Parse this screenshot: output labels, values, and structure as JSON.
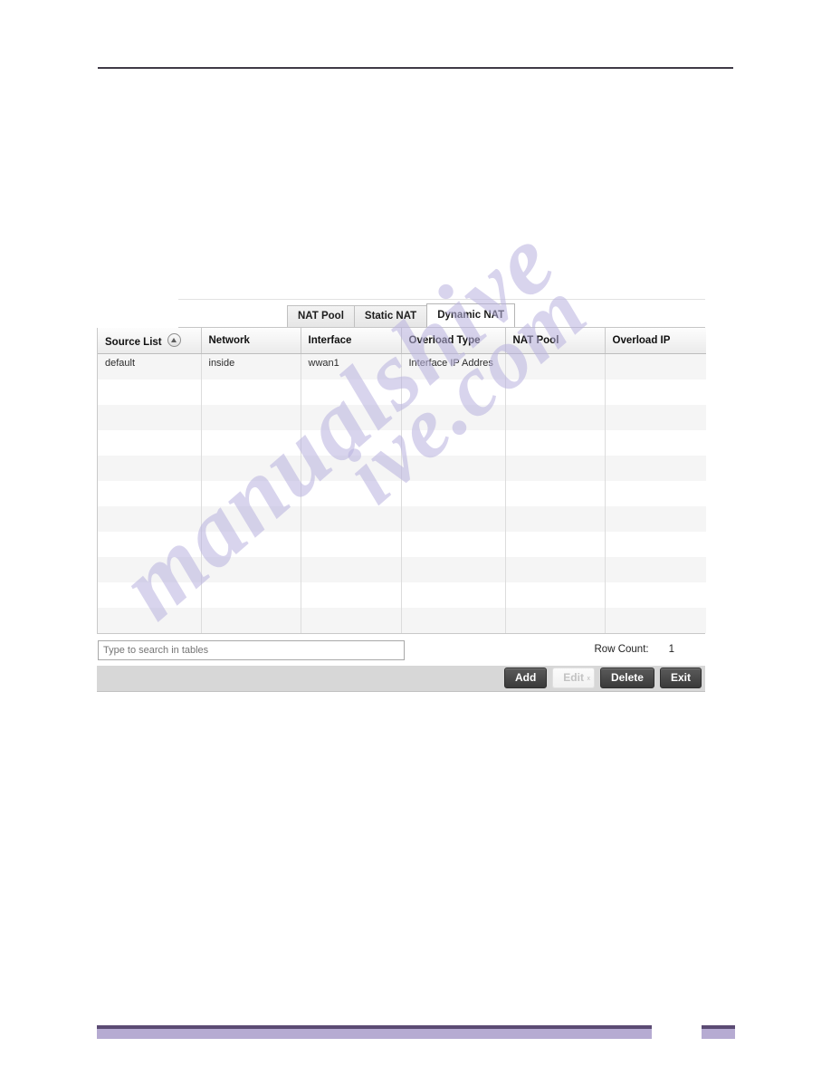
{
  "page": {
    "top_rule": "header-rule"
  },
  "watermark": {
    "line1": "manualshive",
    "line2": "ive.com"
  },
  "figure": {
    "tabs": [
      {
        "label": "NAT Pool",
        "active": false
      },
      {
        "label": "Static NAT",
        "active": false
      },
      {
        "label": "Dynamic NAT",
        "active": true
      }
    ],
    "table": {
      "columns": [
        {
          "label": "Source List",
          "sorted": true,
          "sort_icon": "sort-ascending-icon"
        },
        {
          "label": "Network",
          "sorted": false
        },
        {
          "label": "Interface",
          "sorted": false
        },
        {
          "label": "Overload Type",
          "sorted": false
        },
        {
          "label": "NAT Pool",
          "sorted": false
        },
        {
          "label": "Overload IP",
          "sorted": false
        }
      ],
      "rows": [
        [
          "default",
          "inside",
          "wwan1",
          "Interface IP Addres",
          "",
          ""
        ],
        [
          "",
          "",
          "",
          "",
          "",
          ""
        ],
        [
          "",
          "",
          "",
          "",
          "",
          ""
        ],
        [
          "",
          "",
          "",
          "",
          "",
          ""
        ],
        [
          "",
          "",
          "",
          "",
          "",
          ""
        ],
        [
          "",
          "",
          "",
          "",
          "",
          ""
        ],
        [
          "",
          "",
          "",
          "",
          "",
          ""
        ],
        [
          "",
          "",
          "",
          "",
          "",
          ""
        ],
        [
          "",
          "",
          "",
          "",
          "",
          ""
        ],
        [
          "",
          "",
          "",
          "",
          "",
          ""
        ],
        [
          "",
          "",
          "",
          "",
          "",
          ""
        ]
      ]
    },
    "search": {
      "placeholder": "Type to search in tables",
      "value": ""
    },
    "row_count": {
      "label": "Row Count:",
      "value": "1"
    },
    "buttons": [
      {
        "label": "Add",
        "name": "add-button",
        "disabled": false
      },
      {
        "label": "Edit",
        "name": "edit-button",
        "disabled": true
      },
      {
        "label": "Delete",
        "name": "delete-button",
        "disabled": false
      },
      {
        "label": "Exit",
        "name": "exit-button",
        "disabled": false
      }
    ]
  },
  "colors": {
    "footer_dark": "#5b4b74",
    "footer_light": "#b6abd2",
    "header_rule": "#3f3a46",
    "button_dark": "#3a3a3a",
    "watermark": "#b9b2df"
  }
}
